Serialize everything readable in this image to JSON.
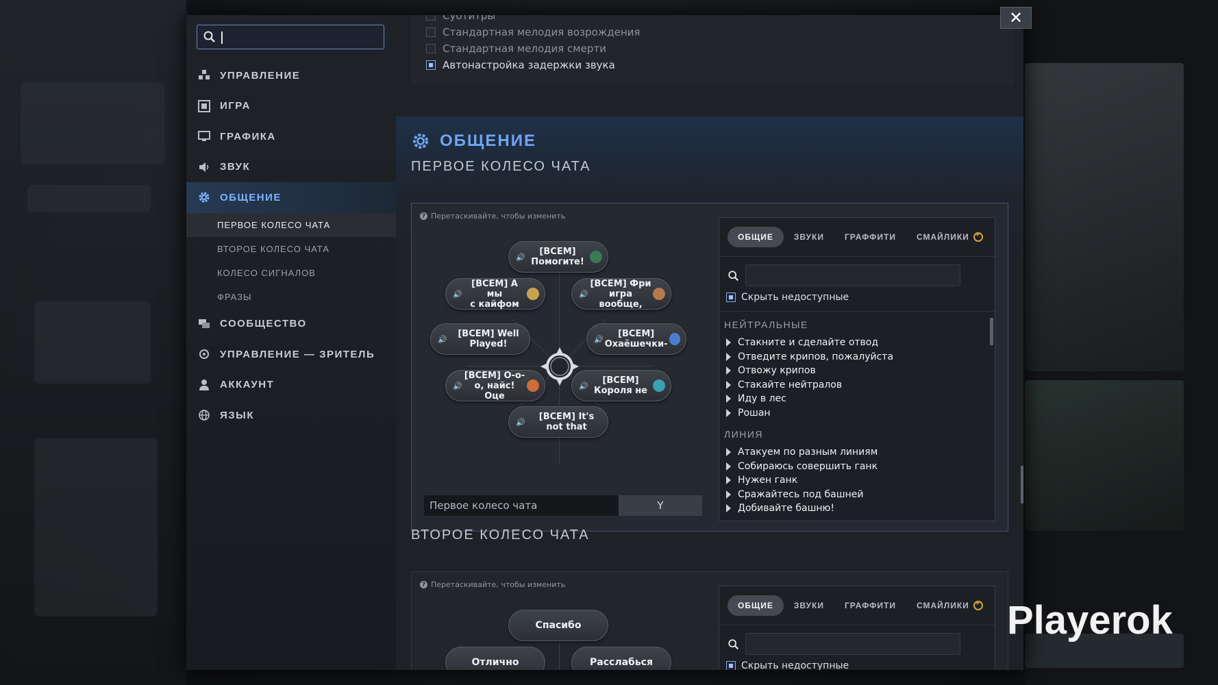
{
  "sidebar": {
    "search_placeholder": "",
    "items": [
      {
        "label": "УПРАВЛЕНИЕ",
        "icon": "controls-icon"
      },
      {
        "label": "ИГРА",
        "icon": "game-icon"
      },
      {
        "label": "ГРАФИКА",
        "icon": "monitor-icon"
      },
      {
        "label": "ЗВУК",
        "icon": "speaker-icon"
      },
      {
        "label": "ОБЩЕНИЕ",
        "icon": "gear-icon",
        "active": true
      },
      {
        "label": "СООБЩЕСТВО",
        "icon": "chat-bubbles-icon"
      },
      {
        "label": "УПРАВЛЕНИЕ — ЗРИТЕЛЬ",
        "icon": "spectator-icon"
      },
      {
        "label": "АККАУНТ",
        "icon": "user-icon"
      },
      {
        "label": "ЯЗЫК",
        "icon": "globe-icon"
      }
    ],
    "sub_items": [
      {
        "label": "ПЕРВОЕ КОЛЕСО ЧАТА",
        "active": true
      },
      {
        "label": "ВТОРОЕ КОЛЕСО ЧАТА"
      },
      {
        "label": "КОЛЕСО СИГНАЛОВ"
      },
      {
        "label": "ФРАЗЫ"
      }
    ]
  },
  "sound_options": [
    {
      "label": "Субтитры",
      "checked": false
    },
    {
      "label": "Стандартная мелодия возрождения",
      "checked": false
    },
    {
      "label": "Стандартная мелодия смерти",
      "checked": false
    },
    {
      "label": "Автонастройка задержки звука",
      "checked": true
    }
  ],
  "section": {
    "title": "ОБЩЕНИЕ",
    "first_wheel_heading": "ПЕРВОЕ КОЛЕСО ЧАТА",
    "second_wheel_heading": "ВТОРОЕ КОЛЕСО ЧАТА",
    "hint": "Перетаскивайте, чтобы изменить"
  },
  "first_wheel": {
    "slots": [
      {
        "text": "[ВСЕМ]\nПомогите!"
      },
      {
        "text": "[ВСЕМ] Фри\nигра вообще,"
      },
      {
        "text": "[ВСЕМ]\nОхаёшечки-"
      },
      {
        "text": "[ВСЕМ]\nКороля не"
      },
      {
        "text": "[ВСЕМ] It's\nnot that"
      },
      {
        "text": "[ВСЕМ] О-о-\nо, найс! Оце"
      },
      {
        "text": "[ВСЕМ] Well\nPlayed!"
      },
      {
        "text": "[ВСЕМ] А мы\nс кайфом"
      }
    ],
    "wheel_name": "Первое колесо чата",
    "hotkey": "Y"
  },
  "second_wheel": {
    "slots": [
      {
        "text": "Спасибо"
      },
      {
        "text": "Расслабься"
      },
      {
        "text": "Отлично"
      }
    ]
  },
  "phrase_panel": {
    "tabs": [
      "ОБЩИЕ",
      "ЗВУКИ",
      "ГРАФФИТИ",
      "СМАЙЛИКИ"
    ],
    "search_value": "",
    "hide_unavailable": "Скрыть недоступные",
    "categories": [
      {
        "name": "НЕЙТРАЛЬНЫЕ",
        "phrases": [
          "Стакните и сделайте отвод",
          "Отведите крипов, пожалуйста",
          "Отвожу крипов",
          "Стакайте нейтралов",
          "Иду в лес",
          "Рошан"
        ]
      },
      {
        "name": "ЛИНИЯ",
        "phrases": [
          "Атакуем по разным линиям",
          "Собираюсь совершить ганк",
          "Нужен ганк",
          "Сражайтесь под башней",
          "Добивайте башню!"
        ]
      }
    ]
  },
  "colors": {
    "accent": "#6fa5f4",
    "coin": "#d5a23a"
  },
  "watermark": "Playerok"
}
